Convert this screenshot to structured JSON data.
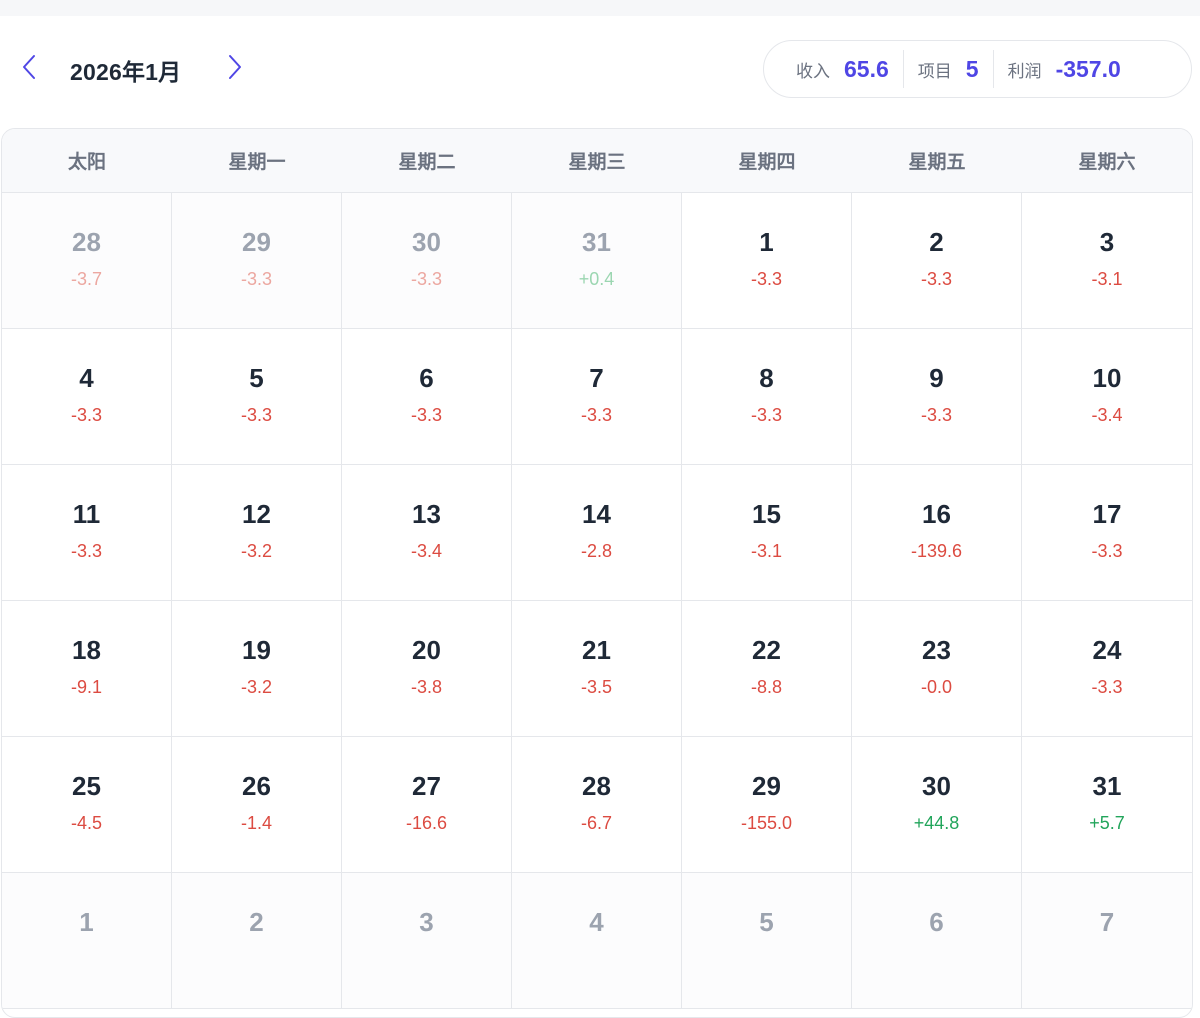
{
  "header": {
    "month_title": "2026年1月",
    "prev_icon": "chevron-left-icon",
    "next_icon": "chevron-right-icon"
  },
  "summary": {
    "income_label": "收入",
    "income_value": "65.6",
    "items_label": "项目",
    "items_value": "5",
    "profit_label": "利润",
    "profit_value": "-357.0"
  },
  "weekdays": [
    "太阳",
    "星期一",
    "星期二",
    "星期三",
    "星期四",
    "星期五",
    "星期六"
  ],
  "days": [
    {
      "day": "28",
      "amount": "-3.7",
      "other": true
    },
    {
      "day": "29",
      "amount": "-3.3",
      "other": true
    },
    {
      "day": "30",
      "amount": "-3.3",
      "other": true
    },
    {
      "day": "31",
      "amount": "+0.4",
      "other": true
    },
    {
      "day": "1",
      "amount": "-3.3",
      "other": false
    },
    {
      "day": "2",
      "amount": "-3.3",
      "other": false
    },
    {
      "day": "3",
      "amount": "-3.1",
      "other": false
    },
    {
      "day": "4",
      "amount": "-3.3",
      "other": false
    },
    {
      "day": "5",
      "amount": "-3.3",
      "other": false
    },
    {
      "day": "6",
      "amount": "-3.3",
      "other": false
    },
    {
      "day": "7",
      "amount": "-3.3",
      "other": false
    },
    {
      "day": "8",
      "amount": "-3.3",
      "other": false
    },
    {
      "day": "9",
      "amount": "-3.3",
      "other": false
    },
    {
      "day": "10",
      "amount": "-3.4",
      "other": false
    },
    {
      "day": "11",
      "amount": "-3.3",
      "other": false
    },
    {
      "day": "12",
      "amount": "-3.2",
      "other": false
    },
    {
      "day": "13",
      "amount": "-3.4",
      "other": false
    },
    {
      "day": "14",
      "amount": "-2.8",
      "other": false
    },
    {
      "day": "15",
      "amount": "-3.1",
      "other": false
    },
    {
      "day": "16",
      "amount": "-139.6",
      "other": false
    },
    {
      "day": "17",
      "amount": "-3.3",
      "other": false
    },
    {
      "day": "18",
      "amount": "-9.1",
      "other": false
    },
    {
      "day": "19",
      "amount": "-3.2",
      "other": false
    },
    {
      "day": "20",
      "amount": "-3.8",
      "other": false
    },
    {
      "day": "21",
      "amount": "-3.5",
      "other": false
    },
    {
      "day": "22",
      "amount": "-8.8",
      "other": false
    },
    {
      "day": "23",
      "amount": "-0.0",
      "other": false
    },
    {
      "day": "24",
      "amount": "-3.3",
      "other": false
    },
    {
      "day": "25",
      "amount": "-4.5",
      "other": false
    },
    {
      "day": "26",
      "amount": "-1.4",
      "other": false
    },
    {
      "day": "27",
      "amount": "-16.6",
      "other": false
    },
    {
      "day": "28",
      "amount": "-6.7",
      "other": false
    },
    {
      "day": "29",
      "amount": "-155.0",
      "other": false
    },
    {
      "day": "30",
      "amount": "+44.8",
      "other": false
    },
    {
      "day": "31",
      "amount": "+5.7",
      "other": false
    },
    {
      "day": "1",
      "amount": "",
      "other": true
    },
    {
      "day": "2",
      "amount": "",
      "other": true
    },
    {
      "day": "3",
      "amount": "",
      "other": true
    },
    {
      "day": "4",
      "amount": "",
      "other": true
    },
    {
      "day": "5",
      "amount": "",
      "other": true
    },
    {
      "day": "6",
      "amount": "",
      "other": true
    },
    {
      "day": "7",
      "amount": "",
      "other": true
    }
  ],
  "colors": {
    "accent": "#4f46e5",
    "negative": "#dc4b41",
    "positive": "#22a55b"
  }
}
